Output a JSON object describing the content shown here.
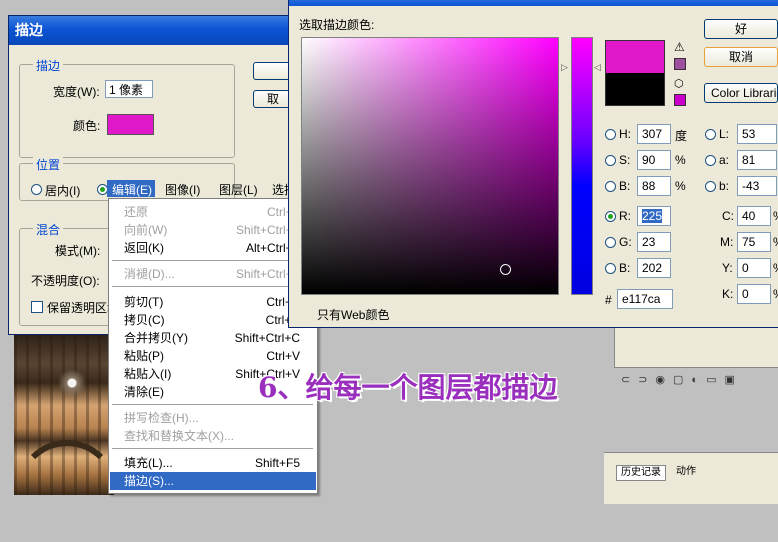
{
  "stroke_dialog": {
    "title": "描边",
    "stroke_group": "描边",
    "width_label": "宽度(W):",
    "width_value": "1 像素",
    "color_label": "颜色:",
    "color_value": "#e117ca",
    "location_group": "位置",
    "inside_label": "居内(I)",
    "blend_group": "混合",
    "mode_label": "模式(M):",
    "opacity_label": "不透明度(O):",
    "preserve_label": "保留透明区域",
    "ok_label": "",
    "cancel_label": "取"
  },
  "menubar": {
    "edit": "编辑(E)",
    "image": "图像(I)",
    "layer": "图层(L)",
    "select": "选择(S)"
  },
  "edit_menu": {
    "items": [
      {
        "label": "还原",
        "shortcut": "Ctrl+Z",
        "disabled": true
      },
      {
        "label": "向前(W)",
        "shortcut": "Shift+Ctrl+Z",
        "disabled": true
      },
      {
        "label": "返回(K)",
        "shortcut": "Alt+Ctrl+Z",
        "disabled": false
      },
      {
        "label": "消褪(D)...",
        "shortcut": "Shift+Ctrl+F",
        "disabled": true
      },
      {
        "label": "剪切(T)",
        "shortcut": "Ctrl+X",
        "disabled": false
      },
      {
        "label": "拷贝(C)",
        "shortcut": "Ctrl+C",
        "disabled": false
      },
      {
        "label": "合并拷贝(Y)",
        "shortcut": "Shift+Ctrl+C",
        "disabled": false
      },
      {
        "label": "粘贴(P)",
        "shortcut": "Ctrl+V",
        "disabled": false
      },
      {
        "label": "粘贴入(I)",
        "shortcut": "Shift+Ctrl+V",
        "disabled": false
      },
      {
        "label": "清除(E)",
        "shortcut": "",
        "disabled": false
      },
      {
        "label": "拼写检查(H)...",
        "shortcut": "",
        "disabled": true
      },
      {
        "label": "查找和替换文本(X)...",
        "shortcut": "",
        "disabled": true
      },
      {
        "label": "填充(L)...",
        "shortcut": "Shift+F5",
        "disabled": false
      },
      {
        "label": "描边(S)...",
        "shortcut": "",
        "disabled": false,
        "selected": true
      }
    ]
  },
  "color_picker": {
    "heading": "选取描边颜色:",
    "ok_label": "好",
    "cancel_label": "取消",
    "libraries_label": "Color Librarie",
    "web_only_label": "只有Web颜色",
    "new_color": "#e117ca",
    "old_color": "#000000",
    "H": {
      "label": "H:",
      "value": "307",
      "unit": "度"
    },
    "S": {
      "label": "S:",
      "value": "90",
      "unit": "%"
    },
    "Bv": {
      "label": "B:",
      "value": "88",
      "unit": "%"
    },
    "R": {
      "label": "R:",
      "value": "225"
    },
    "G": {
      "label": "G:",
      "value": "23"
    },
    "Bc": {
      "label": "B:",
      "value": "202"
    },
    "L": {
      "label": "L:",
      "value": "53"
    },
    "a": {
      "label": "a:",
      "value": "81"
    },
    "b": {
      "label": "b:",
      "value": "-43"
    },
    "C": {
      "label": "C:",
      "value": "40",
      "unit": "%"
    },
    "M": {
      "label": "M:",
      "value": "75",
      "unit": "%"
    },
    "Y": {
      "label": "Y:",
      "value": "0",
      "unit": "%"
    },
    "K": {
      "label": "K:",
      "value": "0",
      "unit": "%"
    },
    "hex_label": "#",
    "hex_value": "e117ca"
  },
  "history_panel": {
    "tab_history": "历史记录",
    "tab_actions": "动作"
  },
  "caption": "6、给每一个图层都描边"
}
